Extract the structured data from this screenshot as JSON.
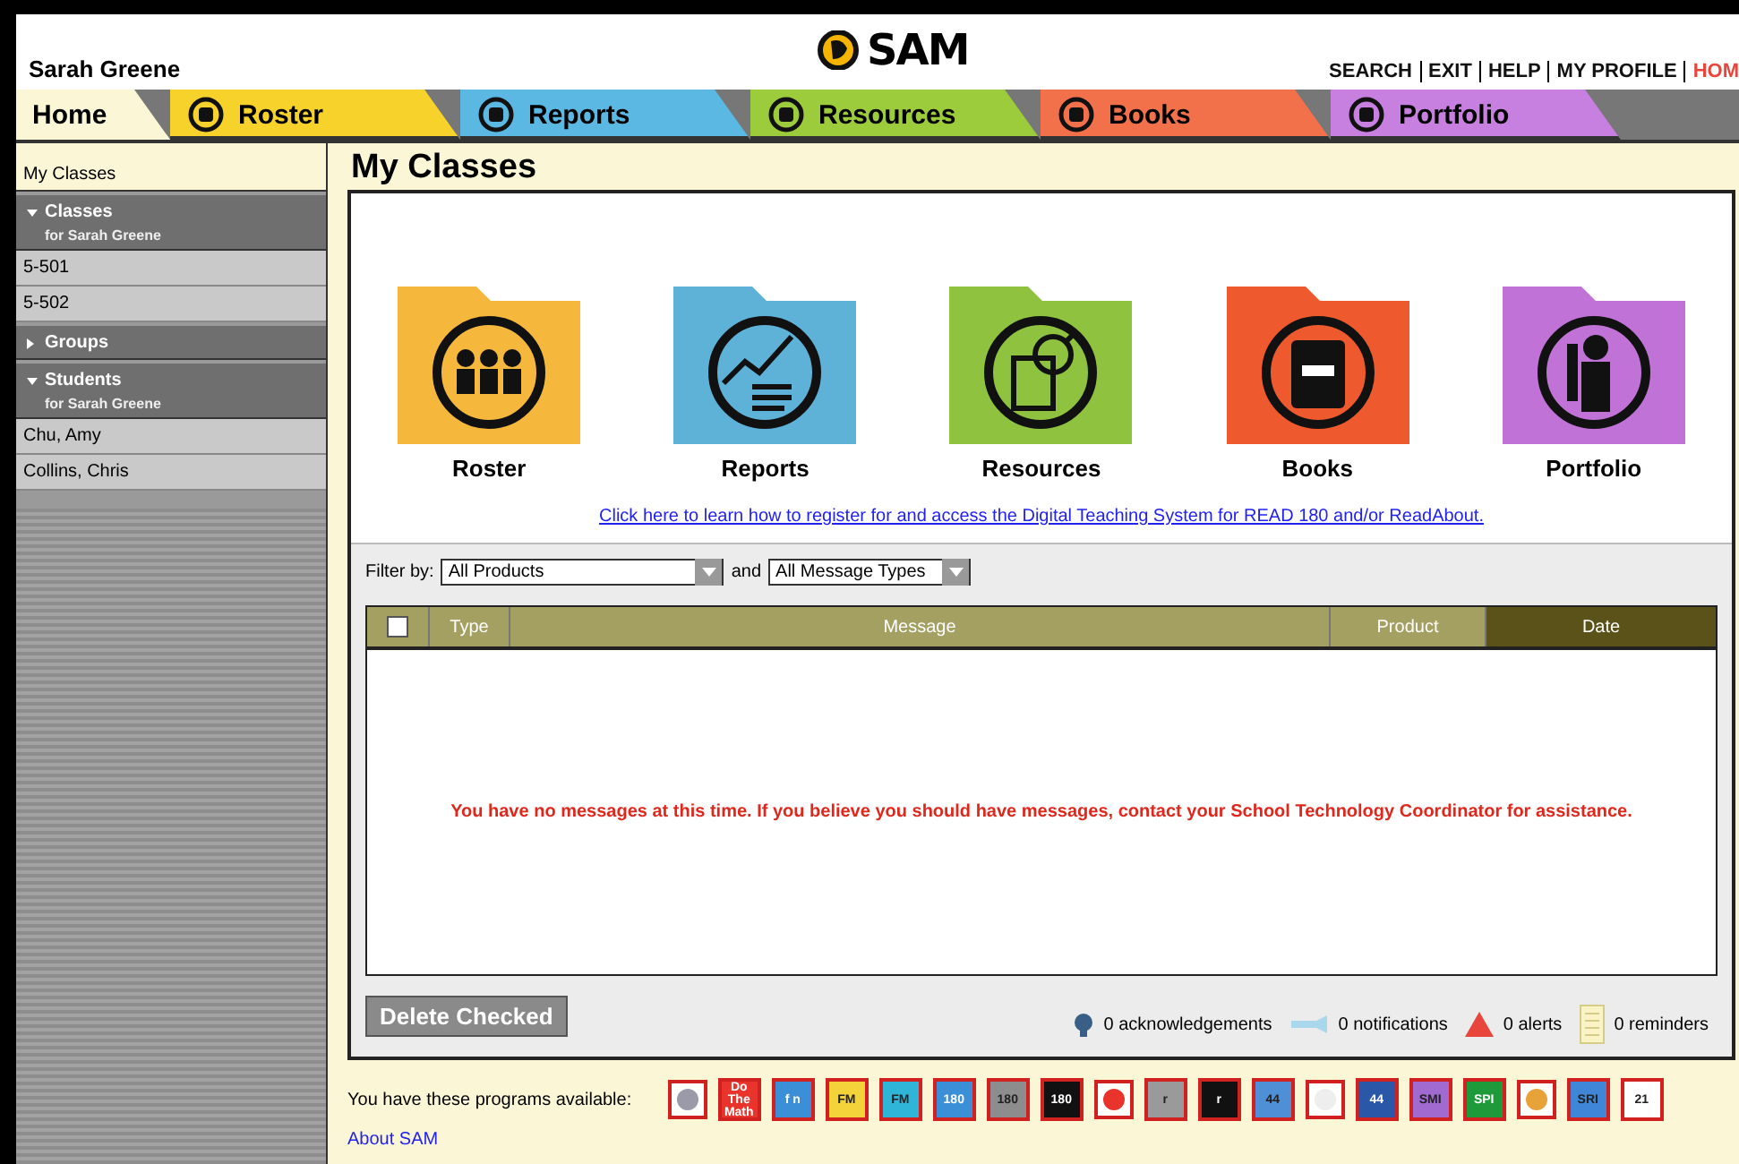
{
  "header": {
    "user": "Sarah Greene",
    "logo": "SAM",
    "links": [
      {
        "label": "SEARCH",
        "selected": false
      },
      {
        "label": "EXIT",
        "selected": false
      },
      {
        "label": "HELP",
        "selected": false
      },
      {
        "label": "MY PROFILE",
        "selected": false
      },
      {
        "label": "HOM",
        "selected": true
      }
    ]
  },
  "tabs": [
    {
      "label": "Home",
      "selected": true
    },
    {
      "label": "Roster",
      "selected": false,
      "color": "#f6d22a"
    },
    {
      "label": "Reports",
      "selected": false,
      "color": "#5bb8e3"
    },
    {
      "label": "Resources",
      "selected": false,
      "color": "#9ccb3b"
    },
    {
      "label": "Books",
      "selected": false,
      "color": "#f2714a"
    },
    {
      "label": "Portfolio",
      "selected": false,
      "color": "#c77fe0"
    }
  ],
  "sidebar": {
    "breadcrumb": "My Classes",
    "sections": [
      {
        "title": "Classes",
        "subtitle": "for Sarah Greene",
        "expanded": true,
        "items": [
          "5-501",
          "5-502"
        ]
      },
      {
        "title": "Groups",
        "expanded": false
      },
      {
        "title": "Students",
        "subtitle": "for Sarah Greene",
        "expanded": true,
        "items": [
          "Chu, Amy",
          "Collins, Chris"
        ]
      }
    ]
  },
  "main": {
    "title": "My Classes",
    "folders": [
      {
        "label": "Roster",
        "color": "#f5b73c",
        "kind": "people"
      },
      {
        "label": "Reports",
        "color": "#5eb2d8",
        "kind": "chart"
      },
      {
        "label": "Resources",
        "color": "#8fc23f",
        "kind": "magnifier"
      },
      {
        "label": "Books",
        "color": "#ee5a2e",
        "kind": "book"
      },
      {
        "label": "Portfolio",
        "color": "#c072d6",
        "kind": "person"
      }
    ],
    "help_link": "Click here to learn how to register for and access the Digital Teaching System for READ 180 and/or ReadAbout.",
    "filter": {
      "label": "Filter by:",
      "product": "All Products",
      "joiner": "and",
      "type": "All Message Types"
    },
    "table": {
      "columns": [
        {
          "kind": "checkbox",
          "checked": false
        },
        {
          "label": "Type",
          "kind": "text",
          "sorted": false
        },
        {
          "label": "Message",
          "kind": "text",
          "sorted": false
        },
        {
          "label": "Product",
          "kind": "text",
          "sorted": false
        },
        {
          "label": "Date",
          "kind": "text",
          "sorted": true
        }
      ],
      "empty_message": "You have no messages at this time. If you believe you should have messages, contact your School Technology Coordinator for assistance."
    },
    "delete_button": "Delete Checked",
    "counts": [
      {
        "kind": "acknowledgement",
        "text": "0 acknowledgements"
      },
      {
        "kind": "notification",
        "text": "0 notifications"
      },
      {
        "kind": "alert",
        "text": "0 alerts"
      },
      {
        "kind": "reminder",
        "text": "0 reminders"
      }
    ]
  },
  "programs": {
    "label": "You have these programs available:",
    "items": [
      {
        "color": "#9a9aa8"
      },
      {
        "label": "Do The Math",
        "color": "#e8342b"
      },
      {
        "label": "f n",
        "color": "#3b8fd6"
      },
      {
        "label": "FM",
        "color": "#f4d33a"
      },
      {
        "label": "FM",
        "color": "#2fb5d8"
      },
      {
        "label": "180",
        "color": "#3b8fd6"
      },
      {
        "label": "180",
        "color": "#8d8d8d"
      },
      {
        "label": "180",
        "color": "#111111"
      },
      {
        "color": "#e8342b"
      },
      {
        "label": "r",
        "color": "#9a9a9a"
      },
      {
        "label": "r",
        "color": "#111111"
      },
      {
        "label": "44",
        "color": "#4f8fd6"
      },
      {
        "color": "#eeeeee"
      },
      {
        "label": "44",
        "color": "#2b57a8"
      },
      {
        "label": "SMI",
        "color": "#a06ad0"
      },
      {
        "label": "SPI",
        "color": "#1e9a3b"
      },
      {
        "color": "#e8a23a"
      },
      {
        "label": "SRI",
        "color": "#3f86d8"
      },
      {
        "label": "21",
        "color": "#ffffff"
      }
    ],
    "about": "About SAM"
  }
}
